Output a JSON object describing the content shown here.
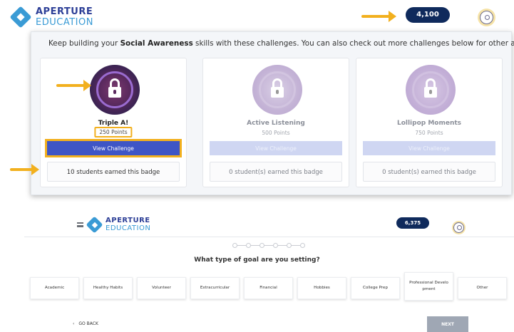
{
  "brand": {
    "line1": "APERTURE",
    "line2": "EDUCATION",
    "primary_color": "#2d3f97",
    "accent_color": "#3a9bd5"
  },
  "top": {
    "points": "4,100",
    "intro_pre": "Keep building your ",
    "intro_bold": "Social Awareness",
    "intro_post": " skills with these challenges. You can also check out more challenges below for other areas.",
    "cards": [
      {
        "title": "Triple A!",
        "points": "250 Points",
        "button": "View Challenge",
        "earned": "10 students earned this badge",
        "state": "active"
      },
      {
        "title": "Active Listening",
        "points": "500 Points",
        "button": "View Challenge",
        "earned": "0 student(s) earned this badge",
        "state": "disabled"
      },
      {
        "title": "Lollipop Moments",
        "points": "750 Points",
        "button": "View Challenge",
        "earned": "0 student(s) earned this badge",
        "state": "disabled"
      }
    ],
    "highlight_color": "#f2b01e",
    "button_color": "#3e55c6"
  },
  "bottom": {
    "points": "6,375",
    "question": "What type of goal are you setting?",
    "goals": [
      "Academic",
      "Healthy Habits",
      "Volunteer",
      "Extracurricular",
      "Financial",
      "Hobbies",
      "College Prep",
      "Professional Develo pment",
      "Other"
    ],
    "go_back": "GO BACK",
    "next": "NEXT"
  }
}
